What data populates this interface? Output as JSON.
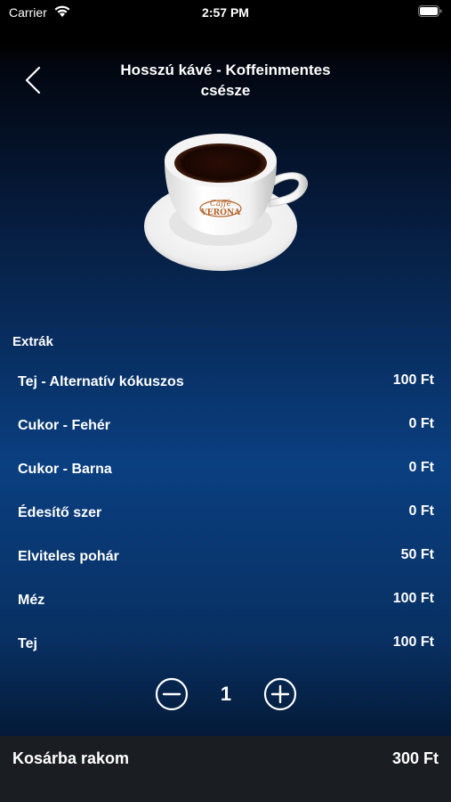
{
  "status_bar": {
    "carrier": "Carrier",
    "time": "2:57 PM"
  },
  "header": {
    "title_line1": "Hosszú kávé - Koffeinmentes",
    "title_line2": "csésze",
    "back_icon": "chevron-left-icon"
  },
  "product": {
    "image_brand_text": "Caffè Verona"
  },
  "extras": {
    "heading": "Extrák",
    "items": [
      {
        "name": "Tej - Alternatív kókuszos",
        "price": "100 Ft"
      },
      {
        "name": "Cukor - Fehér",
        "price": "0 Ft"
      },
      {
        "name": "Cukor - Barna",
        "price": "0 Ft"
      },
      {
        "name": "Édesítő szer",
        "price": "0 Ft"
      },
      {
        "name": "Elviteles pohár",
        "price": "50 Ft"
      },
      {
        "name": "Méz",
        "price": "100 Ft"
      },
      {
        "name": "Tej",
        "price": "100 Ft"
      }
    ]
  },
  "quantity": {
    "value": "1",
    "minus_icon": "minus-circle-icon",
    "plus_icon": "plus-circle-icon"
  },
  "cart": {
    "label": "Kosárba rakom",
    "total": "300 Ft"
  },
  "colors": {
    "background_top": "#000000",
    "background_mid": "#0a3f80",
    "cart_bar": "#1a1d21",
    "text": "#ffffff"
  }
}
